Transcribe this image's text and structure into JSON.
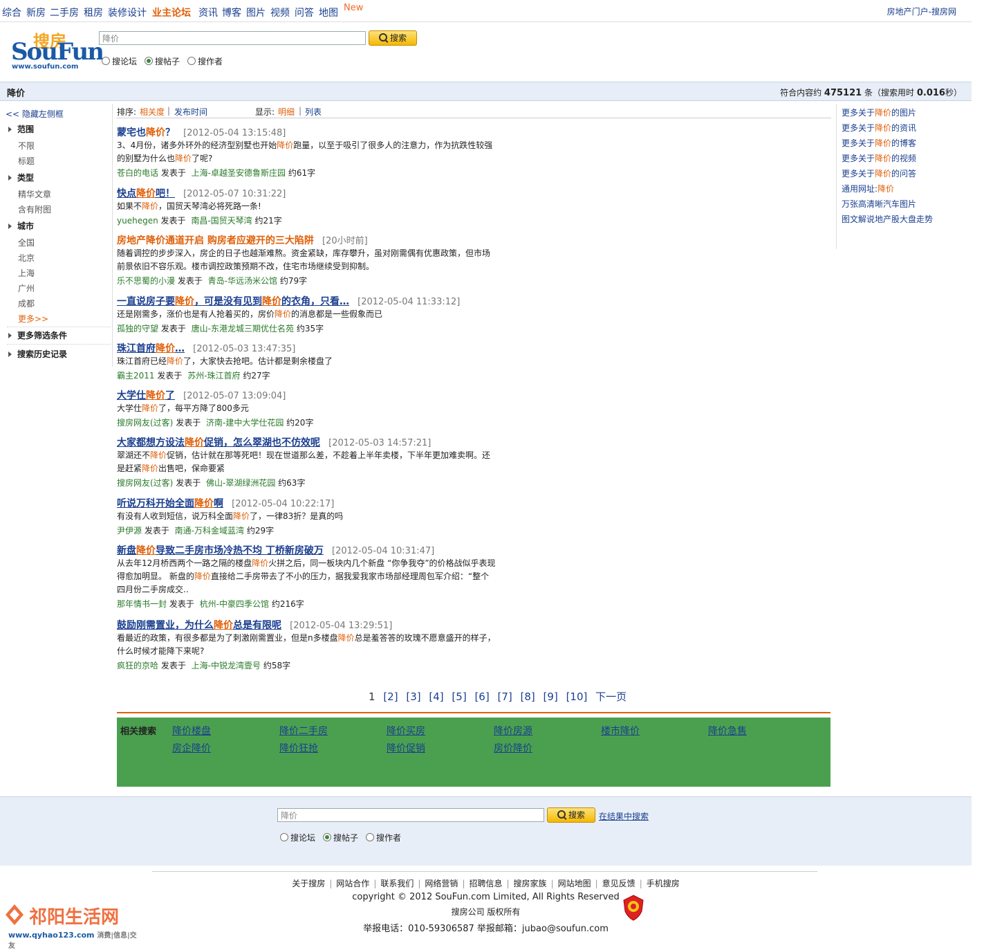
{
  "topnav": {
    "items": [
      "综合",
      "新房",
      "二手房",
      "租房",
      "装修设计",
      "业主论坛",
      "资讯",
      "博客",
      "图片",
      "视频",
      "问答",
      "地图"
    ],
    "new_badge": "New",
    "portal": "房地产门户-搜房网"
  },
  "logo": {
    "cn": "搜房",
    "en": "SouFun",
    "url": "www.soufun.com"
  },
  "search": {
    "value": "降价",
    "button": "搜索",
    "radios": [
      "搜论坛",
      "搜帖子",
      "搜作者"
    ],
    "selected": "搜帖子"
  },
  "querybar": {
    "query": "降价",
    "count_prefix": "符合内容约",
    "count": "475121",
    "count_suffix": "条（搜索用时",
    "time": "0.016",
    "time_suffix": "秒）"
  },
  "sidebar": {
    "hide": "<< 隐藏左侧框",
    "sections": {
      "range": "范围",
      "type": "类型",
      "city": "城市",
      "more_filters": "更多筛选条件",
      "history": "搜索历史记录"
    },
    "range_items": [
      "不限",
      "标题"
    ],
    "type_items": [
      "精华文章",
      "含有附图"
    ],
    "city_items": [
      "全国",
      "北京",
      "上海",
      "广州",
      "成都"
    ],
    "city_more": "更多>>"
  },
  "sortbar": {
    "sort_label": "排序:",
    "sort_relevance": "相关度",
    "sort_sep": "|",
    "sort_time": "发布时间",
    "display_label": "显示:",
    "display_detail": "明细",
    "display_list": "列表"
  },
  "results": [
    {
      "title": [
        [
          "蒙宅也",
          0
        ],
        [
          "降价",
          1
        ],
        [
          "？",
          0
        ]
      ],
      "underline": false,
      "date": "[2012-05-04 13:15:48]",
      "body": [
        [
          [
            "3、4月份，诸多外环外的经济型别墅也开始",
            0
          ],
          [
            "降价",
            1
          ],
          [
            "跑量，以至于吸引了很多人的注意力，作为抗跌性较强",
            0
          ]
        ],
        [
          [
            "的别墅为什么也",
            0
          ],
          [
            "降价",
            1
          ],
          [
            "了呢?",
            0
          ]
        ]
      ],
      "author": "苍白的电话",
      "posted": "发表于",
      "forum": "上海-卓越圣安德鲁斯庄园",
      "words": "约61字"
    },
    {
      "title": [
        [
          "快点",
          0
        ],
        [
          "降价",
          1
        ],
        [
          "吧！",
          0
        ]
      ],
      "underline": true,
      "date": "[2012-05-07 10:31:22]",
      "body": [
        [
          [
            "如果不",
            0
          ],
          [
            "降价",
            1
          ],
          [
            "，国贸天琴湾必将死路一条!",
            0
          ]
        ]
      ],
      "author": "yuehegen",
      "posted": "发表于",
      "forum": "南昌-国贸天琴湾",
      "words": "约21字"
    },
    {
      "title": [
        [
          "房地产",
          1
        ],
        [
          "降价",
          1
        ],
        [
          "通道开启 购房者应避开的三大陷阱",
          1
        ]
      ],
      "underline": false,
      "date": "[20小时前]",
      "body": [
        [
          [
            "随着调控的步步深入，房企的日子也越渐难熬。资金紧缺，库存攀升，虽对刚需偶有优惠政策，但市场",
            0
          ]
        ],
        [
          [
            "前景依旧不容乐观。楼市调控政策预期不改，住宅市场继续受到抑制。",
            0
          ]
        ]
      ],
      "author": "乐不思蜀的小漫",
      "posted": "发表于",
      "forum": "青岛-华远汤米公馆",
      "words": "约79字"
    },
    {
      "title": [
        [
          "一直说房子要",
          0
        ],
        [
          "降价",
          1
        ],
        [
          "，可是没有见到",
          0
        ],
        [
          "降价",
          1
        ],
        [
          "的衣角，只看…",
          0
        ]
      ],
      "underline": true,
      "date": "[2012-05-04 11:33:12]",
      "body": [
        [
          [
            "还是刚需多，涨价也是有人抢着买的，房价",
            0
          ],
          [
            "降价",
            1
          ],
          [
            "的消息都是一些假象而已",
            0
          ]
        ]
      ],
      "author": "孤独的守望",
      "posted": "发表于",
      "forum": "唐山-东港龙城三期优仕名苑",
      "words": "约35字"
    },
    {
      "title": [
        [
          "珠江首府",
          0
        ],
        [
          "降价",
          1
        ],
        [
          "…",
          0
        ]
      ],
      "underline": true,
      "date": "[2012-05-03 13:47:35]",
      "body": [
        [
          [
            "珠江首府已经",
            0
          ],
          [
            "降价",
            1
          ],
          [
            "了，大家快去抢吧。估计都是剩余楼盘了",
            0
          ]
        ]
      ],
      "author": "霸主2011",
      "posted": "发表于",
      "forum": "苏州-珠江首府",
      "words": "约27字"
    },
    {
      "title": [
        [
          "大学仕",
          0
        ],
        [
          "降价",
          1
        ],
        [
          "了",
          0
        ]
      ],
      "underline": true,
      "date": "[2012-05-07 13:09:04]",
      "body": [
        [
          [
            "大学仕",
            0
          ],
          [
            "降价",
            1
          ],
          [
            "了，每平方降了800多元",
            0
          ]
        ]
      ],
      "author": "搜房网友(过客)",
      "posted": "发表于",
      "forum": "济南-建中大学仕花园",
      "words": "约20字"
    },
    {
      "title": [
        [
          "大家都想方设法",
          0
        ],
        [
          "降价",
          1
        ],
        [
          "促销，怎么翠湖也不仿效呢",
          0
        ]
      ],
      "underline": true,
      "date": "[2012-05-03 14:57:21]",
      "body": [
        [
          [
            "翠湖还不",
            0
          ],
          [
            "降价",
            1
          ],
          [
            "促销，估计就在那等死吧！现在世道那么差，不趁着上半年卖楼，下半年更加难卖啊。还",
            0
          ]
        ],
        [
          [
            "是赶紧",
            0
          ],
          [
            "降价",
            1
          ],
          [
            "出售吧，保命要紧",
            0
          ]
        ]
      ],
      "author": "搜房网友(过客)",
      "posted": "发表于",
      "forum": "佛山-翠湖绿洲花园",
      "words": "约63字"
    },
    {
      "title": [
        [
          "听说万科开始全面",
          0
        ],
        [
          "降价",
          1
        ],
        [
          "啊",
          0
        ]
      ],
      "underline": true,
      "date": "[2012-05-04 10:22:17]",
      "body": [
        [
          [
            "有没有人收到短信，说万科全面",
            0
          ],
          [
            "降价",
            1
          ],
          [
            "了，一律83折？是真的吗",
            0
          ]
        ]
      ],
      "author": "尹伊源",
      "posted": "发表于",
      "forum": "南通-万科金域蓝湾",
      "words": "约29字"
    },
    {
      "title": [
        [
          "新盘",
          0
        ],
        [
          "降价",
          1
        ],
        [
          "导致二手房市场冷热不均 丁桥新房破万",
          0
        ]
      ],
      "underline": true,
      "date": "[2012-05-04 10:31:47]",
      "body": [
        [
          [
            "从去年12月桥西两个一路之隔的楼盘",
            0
          ],
          [
            "降价",
            1
          ],
          [
            "火拼之后，同一板块内几个新盘 “你争我夺”的价格战似乎表现",
            0
          ]
        ],
        [
          [
            "得愈加明显。  新盘的",
            0
          ],
          [
            "降价",
            1
          ],
          [
            "直接给二手房带去了不小的压力，据我爱我家市场部经理周包军介绍：“整个",
            0
          ]
        ],
        [
          [
            "四月份二手房成交..",
            0
          ]
        ]
      ],
      "author": "那年情书一封",
      "posted": "发表于",
      "forum": "杭州-中豪四季公馆",
      "words": "约216字"
    },
    {
      "title": [
        [
          "鼓励刚需置业，为什么",
          0
        ],
        [
          "降价",
          1
        ],
        [
          "总是有限呢",
          0
        ]
      ],
      "underline": true,
      "date": "[2012-05-04 13:29:51]",
      "body": [
        [
          [
            "看最近的政策，有很多都是为了刺激刚需置业，但是n多楼盘",
            0
          ],
          [
            "降价",
            1
          ],
          [
            "总是羞答答的玫瑰不愿意盛开的样子，",
            0
          ]
        ],
        [
          [
            "什么时候才能降下来呢?",
            0
          ]
        ]
      ],
      "author": "疯狂的京哈",
      "posted": "发表于",
      "forum": "上海-中锐龙湾壹号",
      "words": "约58字"
    }
  ],
  "rightcol": {
    "links": [
      [
        [
          "更多关于",
          0
        ],
        [
          "降价",
          1
        ],
        [
          "的图片",
          0
        ]
      ],
      [
        [
          "更多关于",
          0
        ],
        [
          "降价",
          1
        ],
        [
          "的资讯",
          0
        ]
      ],
      [
        [
          "更多关于",
          0
        ],
        [
          "降价",
          1
        ],
        [
          "的博客",
          0
        ]
      ],
      [
        [
          "更多关于",
          0
        ],
        [
          "降价",
          1
        ],
        [
          "的视频",
          0
        ]
      ],
      [
        [
          "更多关于",
          0
        ],
        [
          "降价",
          1
        ],
        [
          "的问答",
          0
        ]
      ],
      [
        [
          "通用网址:",
          0
        ],
        [
          "降价",
          1
        ]
      ],
      [
        [
          "万张高清晰汽车图片",
          0
        ]
      ],
      [
        [
          "图文解说地产股大盘走势",
          0
        ]
      ]
    ]
  },
  "pager": {
    "current": "1",
    "pages": [
      "[2]",
      "[3]",
      "[4]",
      "[5]",
      "[6]",
      "[7]",
      "[8]",
      "[9]",
      "[10]"
    ],
    "next": "下一页"
  },
  "related": {
    "label": "相关搜索",
    "links": [
      "降价楼盘",
      "降价二手房",
      "降价买房",
      "降价房源",
      "楼市降价",
      "降价急售",
      "房企降价",
      "降价狂抢",
      "降价促销",
      "房价降价"
    ]
  },
  "bottom_search": {
    "value": "降价",
    "button": "搜索",
    "in_results": "在结果中搜索"
  },
  "footer": {
    "links": [
      "关于搜房",
      "网站合作",
      "联系我们",
      "网络营销",
      "招聘信息",
      "搜房家族",
      "网站地图",
      "意见反馈",
      "手机搜房"
    ],
    "copyright": "copyright © 2012 SouFun.com Limited, All Rights Reserved",
    "company": "搜房公司 版权所有",
    "report": "举报电话：010-59306587  举报邮箱：jubao@soufun.com"
  },
  "watermark": {
    "name": "祁阳生活网",
    "url": "www.qyhao123.com",
    "tags": "消费|信息|交友"
  },
  "colors": {
    "accent": "#e0600a",
    "link": "#1a3f8f",
    "green": "#2a7a2a",
    "related_bg": "#4ba04f"
  }
}
